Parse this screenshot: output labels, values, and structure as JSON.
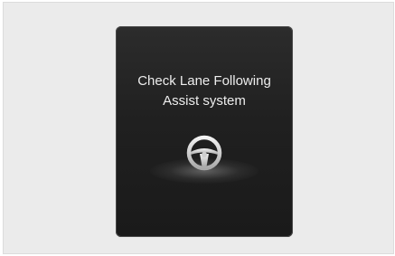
{
  "warning": {
    "line1": "Check Lane Following",
    "line2": "Assist system",
    "icon": "steering-wheel-icon"
  }
}
